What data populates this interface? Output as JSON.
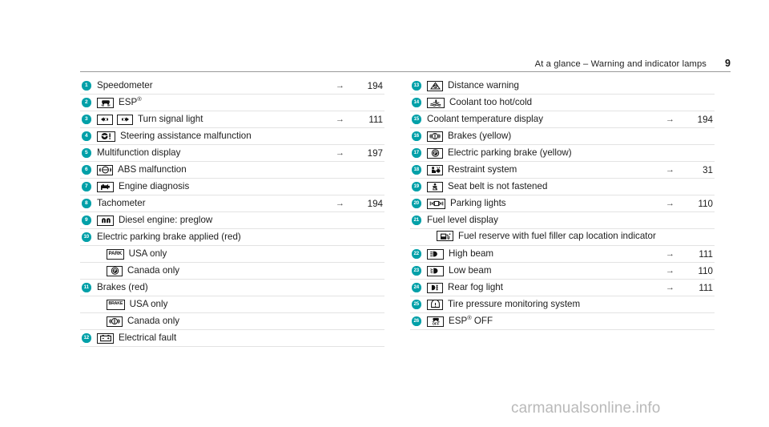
{
  "header": {
    "title": "At a glance – Warning and indicator lamps",
    "page": "9"
  },
  "watermark": "carmanualsonline.info",
  "arrow_glyph": "→",
  "colors": {
    "badge": "#00a0a8",
    "rule": "#e3e3e3",
    "header_rule": "#9a9a9a",
    "text": "#1d1d1d",
    "watermark": "#b9b9b9"
  },
  "left_column": [
    {
      "num": "1",
      "icon": null,
      "label": "Speedometer",
      "arrow": "→",
      "page": "194"
    },
    {
      "num": "2",
      "icon": "esp-icon",
      "label": "ESP",
      "sup": "®",
      "arrow": "",
      "page": ""
    },
    {
      "num": "3",
      "icon": "turn-signal-pair-icon",
      "label": "Turn signal light",
      "arrow": "→",
      "page": "111"
    },
    {
      "num": "4",
      "icon": "steering-assist-icon",
      "label": "Steering assistance malfunction",
      "arrow": "",
      "page": ""
    },
    {
      "num": "5",
      "icon": null,
      "label": "Multifunction display",
      "arrow": "→",
      "page": "197"
    },
    {
      "num": "6",
      "icon": "abs-icon",
      "label": "ABS malfunction",
      "arrow": "",
      "page": ""
    },
    {
      "num": "7",
      "icon": "engine-diagnosis-icon",
      "label": "Engine diagnosis",
      "arrow": "",
      "page": ""
    },
    {
      "num": "8",
      "icon": null,
      "label": "Tachometer",
      "arrow": "→",
      "page": "194"
    },
    {
      "num": "9",
      "icon": "preglow-icon",
      "label": "Diesel engine: preglow",
      "arrow": "",
      "page": ""
    },
    {
      "num": "10",
      "icon": null,
      "label": "Electric parking brake applied (red)",
      "arrow": "",
      "page": ""
    },
    {
      "num": "",
      "icon": "park-text-icon",
      "label": "USA only",
      "indent": true,
      "arrow": "",
      "page": ""
    },
    {
      "num": "",
      "icon": "p-circle-icon",
      "label": "Canada only",
      "indent": true,
      "arrow": "",
      "page": ""
    },
    {
      "num": "11",
      "icon": null,
      "label": "Brakes (red)",
      "arrow": "",
      "page": ""
    },
    {
      "num": "",
      "icon": "brake-text-icon",
      "label": "USA only",
      "indent": true,
      "arrow": "",
      "page": ""
    },
    {
      "num": "",
      "icon": "brake-circle-icon",
      "label": "Canada only",
      "indent": true,
      "arrow": "",
      "page": ""
    },
    {
      "num": "12",
      "icon": "battery-icon",
      "label": "Electrical fault",
      "arrow": "",
      "page": ""
    }
  ],
  "right_column": [
    {
      "num": "13",
      "icon": "distance-warning-icon",
      "label": "Distance warning",
      "arrow": "",
      "page": ""
    },
    {
      "num": "14",
      "icon": "coolant-temp-icon",
      "label": "Coolant too hot/cold",
      "arrow": "",
      "page": ""
    },
    {
      "num": "15",
      "icon": null,
      "label": "Coolant temperature display",
      "arrow": "→",
      "page": "194"
    },
    {
      "num": "16",
      "icon": "brake-circle-icon",
      "label": "Brakes (yellow)",
      "arrow": "",
      "page": ""
    },
    {
      "num": "17",
      "icon": "p-circle-icon",
      "label": "Electric parking brake (yellow)",
      "arrow": "",
      "page": ""
    },
    {
      "num": "18",
      "icon": "restraint-icon",
      "label": "Restraint system",
      "arrow": "→",
      "page": "31"
    },
    {
      "num": "19",
      "icon": "seatbelt-icon",
      "label": "Seat belt is not fastened",
      "arrow": "",
      "page": ""
    },
    {
      "num": "20",
      "icon": "parking-lights-icon",
      "label": "Parking lights",
      "arrow": "→",
      "page": "110"
    },
    {
      "num": "21",
      "icon": null,
      "label": "Fuel level display",
      "arrow": "",
      "page": ""
    },
    {
      "num": "",
      "icon": "fuel-reserve-icon",
      "label": "Fuel reserve with fuel filler cap location indicator",
      "indent": true,
      "wrap": true,
      "arrow": "",
      "page": ""
    },
    {
      "num": "22",
      "icon": "high-beam-icon",
      "label": "High beam",
      "arrow": "→",
      "page": "111"
    },
    {
      "num": "23",
      "icon": "low-beam-icon",
      "label": "Low beam",
      "arrow": "→",
      "page": "110"
    },
    {
      "num": "24",
      "icon": "rear-fog-icon",
      "label": "Rear fog light",
      "arrow": "→",
      "page": "111"
    },
    {
      "num": "25",
      "icon": "tire-pressure-icon",
      "label": "Tire pressure monitoring system",
      "arrow": "",
      "page": ""
    },
    {
      "num": "26",
      "icon": "esp-off-icon",
      "label": "ESP",
      "sup": "®",
      "suffix": " OFF",
      "arrow": "",
      "page": ""
    }
  ]
}
